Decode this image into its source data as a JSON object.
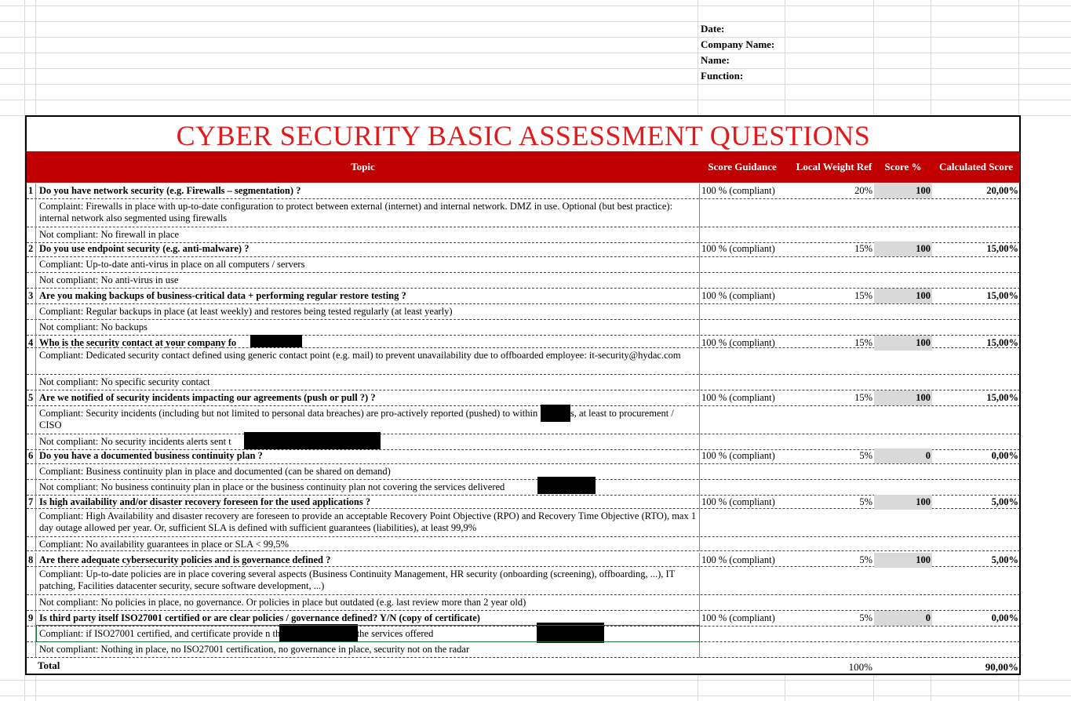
{
  "header_info": {
    "date_label": "Date:",
    "company_label": "Company Name:",
    "name_label": "Name:",
    "function_label": "Function:"
  },
  "title": "CYBER SECURITY BASIC ASSESSMENT QUESTIONS",
  "columns": {
    "topic": "Topic",
    "guidance": "Score Guidance",
    "weight": "Local Weight Ref",
    "score": "Score %",
    "calc": "Calculated Score"
  },
  "questions": [
    {
      "num": "1",
      "q": "Do you have network security  (e.g. Firewalls – segmentation) ?",
      "guidance": "100 % (compliant)",
      "weight": "20%",
      "score": "100",
      "calc": "20,00%",
      "compliant": "Complaint: Firewalls in place with up-to-date configuration to protect between external (internet) and internal network. DMZ in use. Optional (but best practice): internal network also segmented using firewalls",
      "not": "Not compliant: No firewall in place"
    },
    {
      "num": "2",
      "q": "Do you use endpoint security (e.g. anti-malware) ?",
      "guidance": "100 % (compliant)",
      "weight": "15%",
      "score": "100",
      "calc": "15,00%",
      "compliant": "Compliant: Up-to-date anti-virus in place on all computers / servers",
      "not": "Not compliant: No anti-virus in use"
    },
    {
      "num": "3",
      "q": "Are you making backups of business-critical data + performing regular restore testing ?",
      "guidance": "100 % (compliant)",
      "weight": "15%",
      "score": "100",
      "calc": "15,00%",
      "compliant": "Compliant: Regular backups in place (at least weekly) and restores being tested regularly (at least yearly)",
      "not": "Not compliant: No backups"
    },
    {
      "num": "4",
      "q": "Who is the security contact at your company fo",
      "guidance": "100 % (compliant)",
      "weight": "15%",
      "score": "100",
      "calc": "15,00%",
      "compliant": "Compliant: Dedicated security contact defined using generic contact point (e.g. mail) to prevent unavailability due to offboarded employee: it-security@hydac.com",
      "not": "Not compliant: No specific security contact"
    },
    {
      "num": "5",
      "q": "Are we notified of security incidents impacting our agreements (push or pull ?) ?",
      "guidance": "100 % (compliant)",
      "weight": "15%",
      "score": "100",
      "calc": "15,00%",
      "compliant": "Compliant: Security incidents (including but not limited to personal data breaches) are pro-actively reported (pushed) to                within 72 hours, at least to procurement / CISO",
      "not": "Not compliant: No security incidents alerts sent t"
    },
    {
      "num": "6",
      "q": "Do you have a documented business continuity plan ?",
      "guidance": "100 % (compliant)",
      "weight": "5%",
      "score": "0",
      "calc": "0,00%",
      "compliant": "Compliant: Business continuity plan in place and documented (can be shared on demand)",
      "not": "Not compliant: No business continuity plan in place or the business continuity plan not covering the services delivered"
    },
    {
      "num": "7",
      "q": "Is high availability and/or disaster recovery foreseen for the used applications ?",
      "guidance": "100 % (compliant)",
      "weight": "5%",
      "score": "100",
      "calc": "5,00%",
      "compliant": "Compliant: High Availability and disaster recovery are foreseen to provide an acceptable Recovery Point Objective (RPO) and Recovery Time Objective (RTO), max 1 day outage allowed per year. Or, sufficient SLA is defined with sufficient guarantees (liabilities), at least 99,9%",
      "not": "Compliant: No availability guarantees in place or SLA < 99,5%"
    },
    {
      "num": "8",
      "q": "Are there adequate cybersecurity policies and is governance defined ?",
      "guidance": "100 % (compliant)",
      "weight": "5%",
      "score": "100",
      "calc": "5,00%",
      "compliant": "Compliant: Up-to-date policies are in place covering several aspects (Business Continuity Management, HR security (onboarding (screening), offboarding, ...), IT patching, Facilities datacenter security, secure software development, ...)",
      "not": "Not compliant: No policies in place, no governance. Or policies in place but outdated (e.g. last review more than 2 year old)"
    },
    {
      "num": "9",
      "q": "Is third party itself ISO27001 certified or are clear policies / governance defined?  Y/N (copy of certificate)",
      "guidance": "100 % (compliant)",
      "weight": "5%",
      "score": "0",
      "calc": "0,00%",
      "compliant": "Compliant: if ISO27001 certified, and certificate provide                                    n the certificate covers the services offered",
      "not": "Not compliant: Nothing in place, no ISO27001 certification, no governance in place, security not on the radar"
    }
  ],
  "total": {
    "label": "Total",
    "weight": "100%",
    "calc": "90,00%"
  }
}
